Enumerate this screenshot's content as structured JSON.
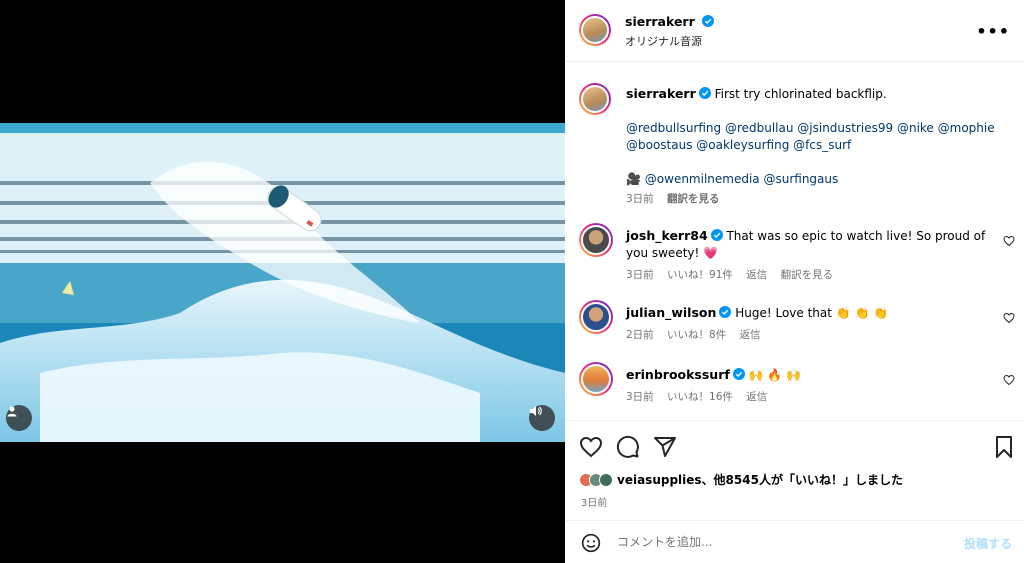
{
  "header": {
    "username": "sierrakerr",
    "subtitle": "オリジナル音源",
    "more_label": "•••"
  },
  "caption": {
    "username": "sierrakerr",
    "text": "First try chlorinated backflip.",
    "tags_line1": "@redbullsurfing @redbullau @jsindustries99 @nike @mophie",
    "tags_line2": "@boostaus @oakleysurfing @fcs_surf",
    "camera_emoji": "🎥",
    "tags_line3": "@owenmilnemedia @surfingaus",
    "time": "3日前",
    "translate": "翻訳を見る"
  },
  "comments": [
    {
      "username": "josh_kerr84",
      "text": "That was so epic to watch live! So proud of you sweety! 💗",
      "time": "3日前",
      "likes": "いいね！91件",
      "reply": "返信",
      "translate": "翻訳を見る"
    },
    {
      "username": "julian_wilson",
      "text": "Huge! Love that 👏 👏 👏",
      "time": "2日前",
      "likes": "いいね！8件",
      "reply": "返信"
    },
    {
      "username": "erinbrookssurf",
      "text": "🙌 🔥 🙌",
      "time": "3日前",
      "likes": "いいね！16件",
      "reply": "返信"
    }
  ],
  "likes": {
    "account": "veiasupplies",
    "rest": "、他8545人が「いいね！」しました"
  },
  "post_date": "3日前",
  "add_comment": {
    "placeholder": "コメントを追加...",
    "post_label": "投稿する"
  },
  "icons": [
    "user-icon",
    "volume-icon",
    "heart-icon",
    "comment-icon",
    "share-icon",
    "bookmark-icon",
    "emoji-icon",
    "verified-icon",
    "more-icon"
  ],
  "colors": {
    "verified": "#0095f6",
    "link": "#00376b",
    "muted": "#737373",
    "post_button": "#b2dffc"
  }
}
